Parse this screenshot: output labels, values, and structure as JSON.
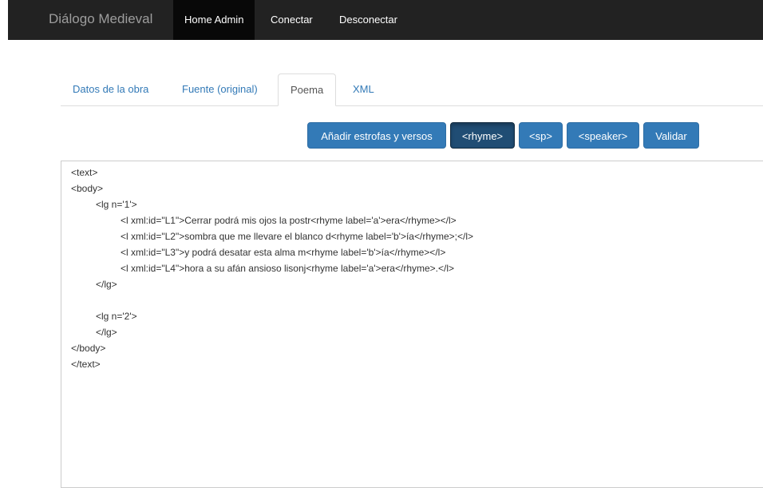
{
  "navbar": {
    "brand": "Diálogo Medieval",
    "items": [
      {
        "label": "Home Admin"
      },
      {
        "label": "Conectar"
      },
      {
        "label": "Desconectar"
      }
    ]
  },
  "tabs": [
    {
      "label": "Datos de la obra"
    },
    {
      "label": "Fuente (original)"
    },
    {
      "label": "Poema",
      "active": true
    },
    {
      "label": "XML"
    }
  ],
  "toolbar": {
    "add_label": "Añadir estrofas y versos",
    "rhyme_label": "<rhyme>",
    "sp_label": "<sp>",
    "speaker_label": "<speaker>",
    "validate_label": "Validar"
  },
  "editor": {
    "lines": [
      "<text>",
      "<body>",
      "<lg n='1'>",
      "<l xml:id=\"L1\">Cerrar podrá mis ojos la postr<rhyme label='a'>era</rhyme></l>",
      "<l xml:id=\"L2\">sombra que me llevare el blanco d<rhyme label='b'>ía</rhyme>;</l>",
      "<l xml:id=\"L3\">y podrá desatar esta alma m<rhyme label='b'>ía</rhyme></l>",
      "<l xml:id=\"L4\">hora a su afán ansioso lisonj<rhyme label='a'>era</rhyme>.</l>",
      "</lg>",
      "",
      "<lg n='2'>",
      "</lg>",
      "</body>",
      "</text>"
    ]
  },
  "colors": {
    "navbar_bg": "#222222",
    "primary": "#337ab7",
    "primary_pressed": "#204d74",
    "link": "#337ab7"
  }
}
